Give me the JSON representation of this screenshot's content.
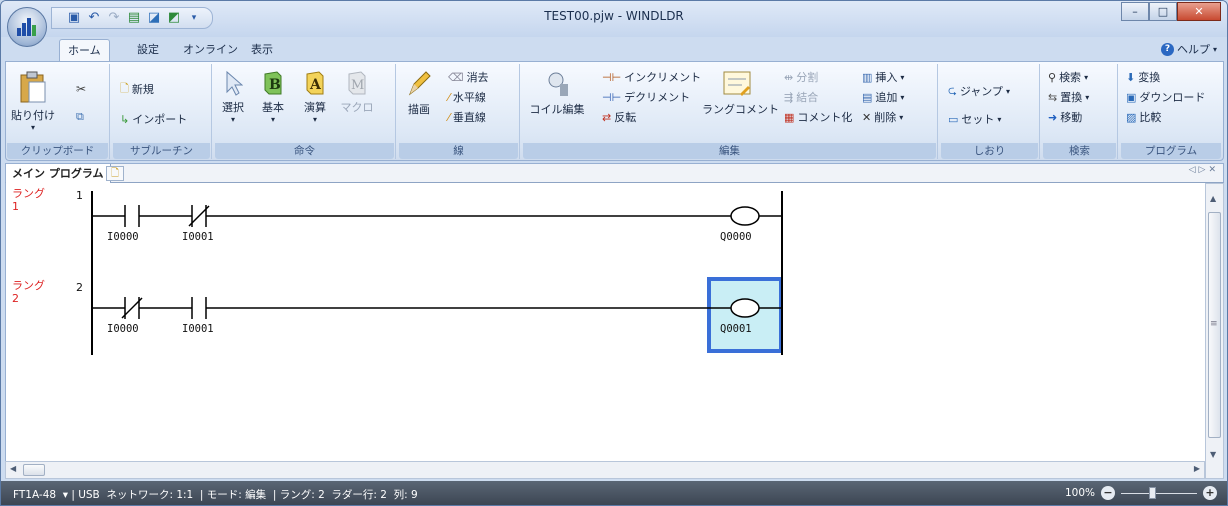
{
  "window": {
    "title": "TEST00.pjw - WINDLDR",
    "controls": [
      "minimize",
      "maximize",
      "close"
    ]
  },
  "quick_access": [
    "save-icon",
    "undo-icon",
    "redo-icon",
    "monitor-icon",
    "download-icon",
    "upload-icon"
  ],
  "menu_tabs": [
    {
      "label": "ホーム",
      "active": true
    },
    {
      "label": "設定",
      "active": false
    },
    {
      "label": "オンライン",
      "active": false
    },
    {
      "label": "表示",
      "active": false
    }
  ],
  "help": {
    "label": "ヘルプ"
  },
  "ribbon": {
    "clipboard": {
      "group": "クリップボード",
      "paste": "貼り付け"
    },
    "subroutine": {
      "group": "サブルーチン",
      "new": "新規",
      "import": "インポート"
    },
    "instruction": {
      "group": "命令",
      "select": "選択",
      "basic": "基本",
      "advanced": "演算",
      "macro": "マクロ"
    },
    "line": {
      "group": "線",
      "draw": "描画",
      "erase": "消去",
      "hline": "水平線",
      "vline": "垂直線"
    },
    "edit": {
      "group": "編集",
      "coil_edit": "コイル編集",
      "increment": "インクリメント",
      "decrement": "デクリメント",
      "invert": "反転",
      "rung_comment": "ラングコメント",
      "split": "分割",
      "join": "結合",
      "comment_out": "コメント化",
      "insert": "挿入",
      "add": "追加",
      "delete": "削除"
    },
    "bookmark": {
      "group": "しおり",
      "jump": "ジャンプ",
      "set": "セット"
    },
    "search": {
      "group": "検索",
      "find": "検索",
      "replace": "置換",
      "move": "移動"
    },
    "program": {
      "group": "プログラム",
      "convert": "変換",
      "download": "ダウンロード",
      "compare": "比較"
    }
  },
  "document": {
    "tab": "メイン プログラム"
  },
  "rungs": [
    {
      "label": "ラング\n1",
      "number": "1",
      "contacts": [
        {
          "type": "NO",
          "name": "I0000"
        },
        {
          "type": "NC",
          "name": "I0001"
        }
      ],
      "coil": "Q0000",
      "selected": false
    },
    {
      "label": "ラング\n2",
      "number": "2",
      "contacts": [
        {
          "type": "NC",
          "name": "I0000"
        },
        {
          "type": "NO",
          "name": "I0001"
        }
      ],
      "coil": "Q0001",
      "selected": true
    }
  ],
  "status": {
    "text": "FT1A-48  ▾ | USB  ネットワーク: 1:1  | モード: 編集  | ラング: 2  ラダー行: 2  列: 9",
    "zoom": "100%"
  }
}
